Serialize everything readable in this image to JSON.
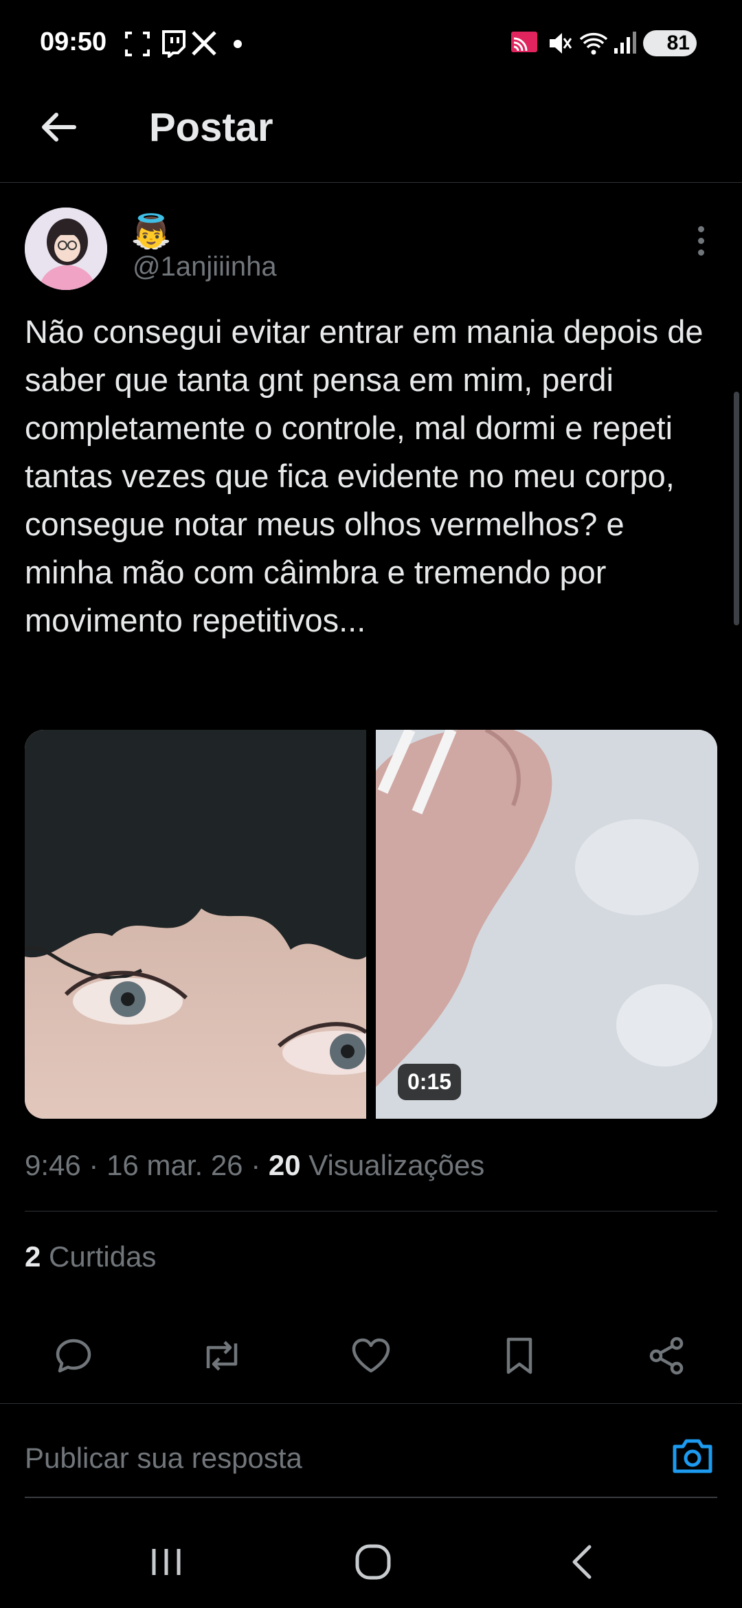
{
  "status_bar": {
    "time": "09:50",
    "battery": "81"
  },
  "header": {
    "title": "Postar"
  },
  "post": {
    "author_emoji": "👼",
    "handle": "@1anjiiinha",
    "text": "Não consegui evitar entrar em mania depois de saber que tanta gnt pensa em mim, perdi completamente o controle, mal dormi e repeti tantas vezes que fica evidente no meu corpo, consegue notar meus olhos vermelhos? e minha mão com câimbra e tremendo por movimento repetitivos...",
    "video_duration": "0:15",
    "meta": {
      "time": "9:46",
      "date": "16 mar. 26",
      "views_count": "20",
      "views_label": "Visualizações"
    },
    "likes": {
      "count": "2",
      "label": "Curtidas"
    }
  },
  "actions": [
    {
      "name": "reply",
      "icon": "comment-icon"
    },
    {
      "name": "repost",
      "icon": "repost-icon"
    },
    {
      "name": "like",
      "icon": "heart-icon"
    },
    {
      "name": "bookmark",
      "icon": "bookmark-icon"
    },
    {
      "name": "share",
      "icon": "share-icon"
    }
  ],
  "reply": {
    "placeholder": "Publicar sua resposta"
  },
  "colors": {
    "background": "#000000",
    "text": "#e7e9ea",
    "secondary": "#71767b",
    "accent": "#1d9bf0",
    "divider": "#2f3336"
  }
}
